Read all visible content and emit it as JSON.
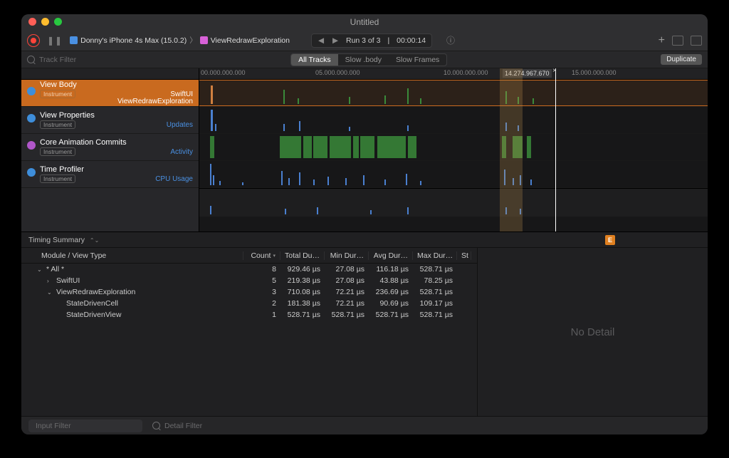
{
  "window": {
    "title": "Untitled"
  },
  "toolbar": {
    "device": "Donny's iPhone 4s Max (15.0.2)",
    "target": "ViewRedrawExploration",
    "run_label": "Run 3 of 3",
    "run_time": "00:00:14"
  },
  "filterbar": {
    "track_filter_placeholder": "Track Filter",
    "segments": [
      "All Tracks",
      "Slow .body",
      "Slow Frames"
    ],
    "duplicate": "Duplicate"
  },
  "ruler": {
    "ticks": [
      "00.000.000.000",
      "05.000.000.000",
      "10.000.000.000",
      "15.000.000.000"
    ],
    "cursor_label": "14.274.967.670"
  },
  "tracks": [
    {
      "name": "View Body",
      "badge": "Instrument",
      "right1": "SwiftUI",
      "right2": "ViewRedrawExploration",
      "dot": "blue",
      "selected": true
    },
    {
      "name": "View Properties",
      "badge": "Instrument",
      "right1": "Updates",
      "dot": "blue",
      "selected": false
    },
    {
      "name": "Core Animation Commits",
      "badge": "Instrument",
      "right1": "Activity",
      "dot": "purple",
      "selected": false
    },
    {
      "name": "Time Profiler",
      "badge": "Instrument",
      "right1": "CPU Usage",
      "dot": "blue",
      "selected": false
    }
  ],
  "detail": {
    "mode": "Timing Summary",
    "ext_badge": "E",
    "no_detail": "No Detail",
    "columns": [
      "Module / View Type",
      "Count",
      "Total Du…",
      "Min Dur…",
      "Avg Dur…",
      "Max Dur…",
      "St"
    ],
    "rows": [
      {
        "indent": 0,
        "disclosure": "open",
        "label": "* All *",
        "count": "8",
        "total": "929.46 µs",
        "min": "27.08 µs",
        "avg": "116.18 µs",
        "max": "528.71 µs"
      },
      {
        "indent": 1,
        "disclosure": "closed",
        "label": "SwiftUI",
        "count": "5",
        "total": "219.38 µs",
        "min": "27.08 µs",
        "avg": "43.88 µs",
        "max": "78.25 µs"
      },
      {
        "indent": 1,
        "disclosure": "open",
        "label": "ViewRedrawExploration",
        "count": "3",
        "total": "710.08 µs",
        "min": "72.21 µs",
        "avg": "236.69 µs",
        "max": "528.71 µs"
      },
      {
        "indent": 2,
        "disclosure": "",
        "label": "StateDrivenCell",
        "count": "2",
        "total": "181.38 µs",
        "min": "72.21 µs",
        "avg": "90.69 µs",
        "max": "109.17 µs"
      },
      {
        "indent": 2,
        "disclosure": "",
        "label": "StateDrivenView",
        "count": "1",
        "total": "528.71 µs",
        "min": "528.71 µs",
        "avg": "528.71 µs",
        "max": "528.71 µs"
      }
    ]
  },
  "bottom": {
    "input_filter": "Input Filter",
    "detail_filter": "Detail Filter"
  }
}
